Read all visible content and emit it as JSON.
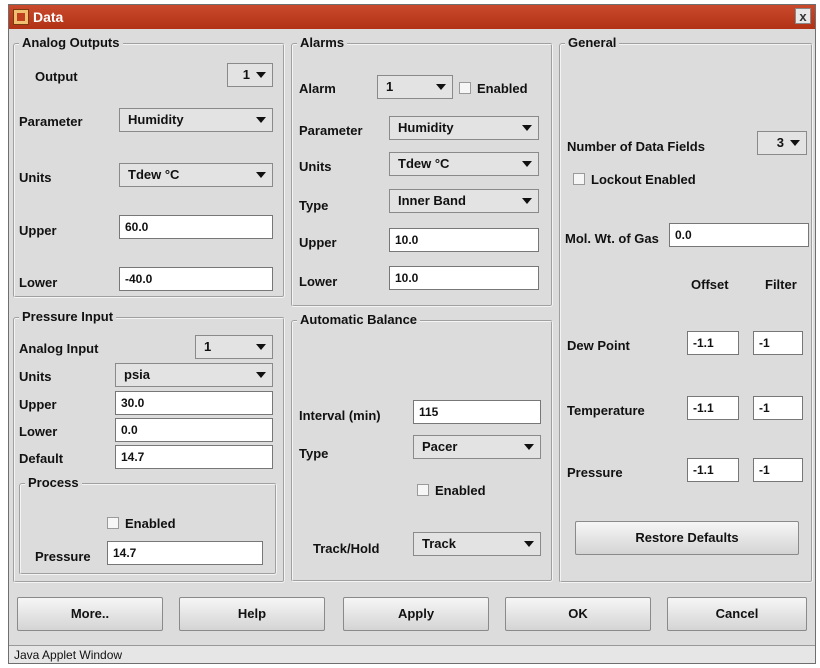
{
  "window": {
    "title": "Data",
    "close_glyph": "x",
    "status": "Java Applet Window"
  },
  "analog_outputs": {
    "legend": "Analog Outputs",
    "output_label": "Output",
    "output_value": "1",
    "parameter_label": "Parameter",
    "parameter_value": "Humidity",
    "units_label": "Units",
    "units_value": "Tdew °C",
    "upper_label": "Upper",
    "upper_value": "60.0",
    "lower_label": "Lower",
    "lower_value": "-40.0"
  },
  "alarms": {
    "legend": "Alarms",
    "alarm_label": "Alarm",
    "alarm_value": "1",
    "enabled_label": "Enabled",
    "parameter_label": "Parameter",
    "parameter_value": "Humidity",
    "units_label": "Units",
    "units_value": "Tdew °C",
    "type_label": "Type",
    "type_value": "Inner Band",
    "upper_label": "Upper",
    "upper_value": "10.0",
    "lower_label": "Lower",
    "lower_value": "10.0"
  },
  "general": {
    "legend": "General",
    "fields_label": "Number of Data Fields",
    "fields_value": "3",
    "lockout_label": "Lockout Enabled",
    "molwt_label": "Mol. Wt. of Gas",
    "molwt_value": "0.0",
    "offset_header": "Offset",
    "filter_header": "Filter",
    "rows": [
      {
        "label": "Dew Point",
        "offset": "-1.1",
        "filter": "-1"
      },
      {
        "label": "Temperature",
        "offset": "-1.1",
        "filter": "-1"
      },
      {
        "label": "Pressure",
        "offset": "-1.1",
        "filter": "-1"
      }
    ],
    "restore_label": "Restore Defaults"
  },
  "pressure_input": {
    "legend": "Pressure Input",
    "analog_label": "Analog Input",
    "analog_value": "1",
    "units_label": "Units",
    "units_value": "psia",
    "upper_label": "Upper",
    "upper_value": "30.0",
    "lower_label": "Lower",
    "lower_value": "0.0",
    "default_label": "Default",
    "default_value": "14.7",
    "process": {
      "legend": "Process",
      "enabled_label": "Enabled",
      "pressure_label": "Pressure",
      "pressure_value": "14.7"
    }
  },
  "automatic_balance": {
    "legend": "Automatic Balance",
    "interval_label": "Interval (min)",
    "interval_value": "115",
    "type_label": "Type",
    "type_value": "Pacer",
    "enabled_label": "Enabled",
    "trackhold_label": "Track/Hold",
    "trackhold_value": "Track"
  },
  "buttons": {
    "more": "More..",
    "help": "Help",
    "apply": "Apply",
    "ok": "OK",
    "cancel": "Cancel"
  }
}
